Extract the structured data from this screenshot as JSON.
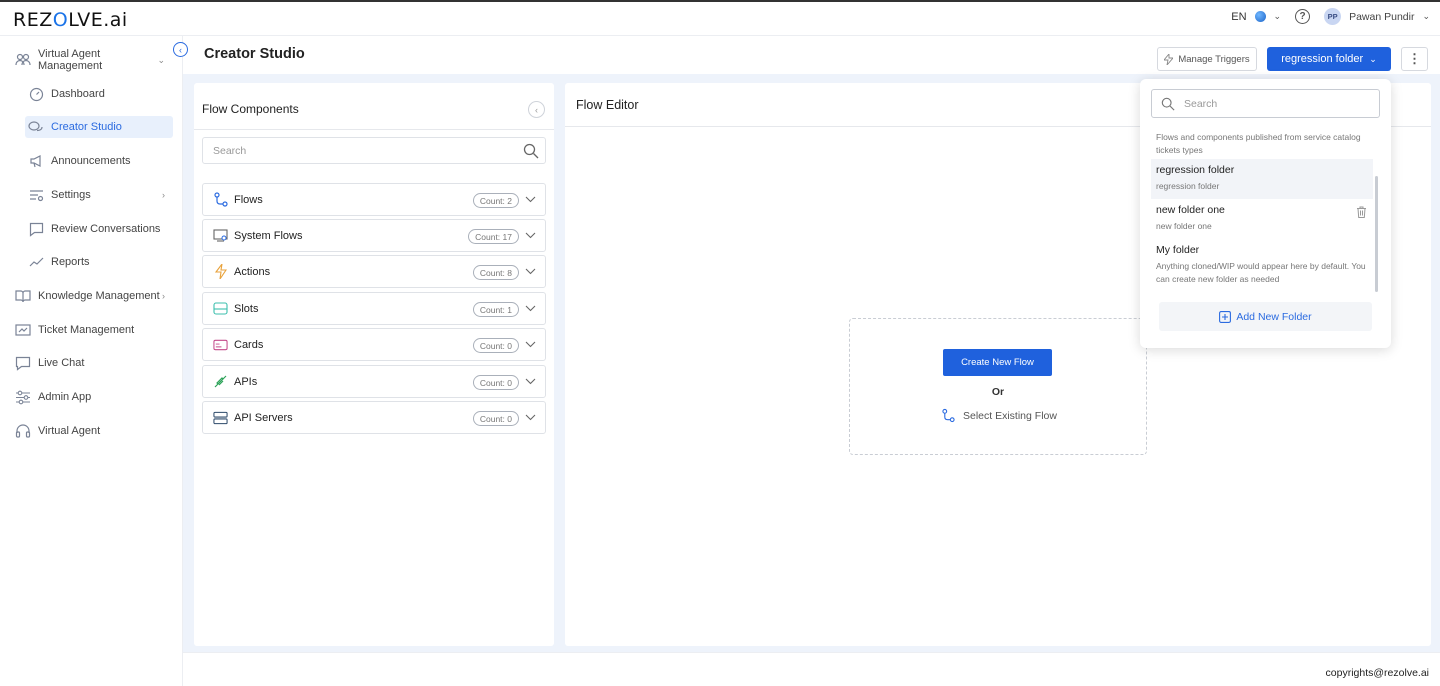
{
  "brand": {
    "logo_pre": "REZ",
    "logo_o": "O",
    "logo_post": "LVE.ai"
  },
  "topbar": {
    "language": "EN",
    "user_initials": "PP",
    "user_name": "Pawan Pundir"
  },
  "sidebar": {
    "items": [
      {
        "label": "Virtual Agent Management",
        "icon": "users-gear-icon"
      },
      {
        "label": "Dashboard",
        "icon": "gauge-icon"
      },
      {
        "label": "Creator Studio",
        "icon": "chat-bubbles-icon"
      },
      {
        "label": "Announcements",
        "icon": "megaphone-icon"
      },
      {
        "label": "Settings",
        "icon": "sliders-icon"
      },
      {
        "label": "Review Conversations",
        "icon": "chat-square-icon"
      },
      {
        "label": "Reports",
        "icon": "trend-icon"
      },
      {
        "label": "Knowledge Management",
        "icon": "book-icon"
      },
      {
        "label": "Ticket Management",
        "icon": "ticket-icon"
      },
      {
        "label": "Live Chat",
        "icon": "live-chat-icon"
      },
      {
        "label": "Admin App",
        "icon": "admin-sliders-icon"
      },
      {
        "label": "Virtual Agent",
        "icon": "headset-icon"
      }
    ]
  },
  "header": {
    "title": "Creator Studio",
    "manage_triggers": "Manage Triggers",
    "folder_button": "regression folder"
  },
  "flow_components": {
    "title": "Flow Components",
    "search_placeholder": "Search",
    "rows": [
      {
        "label": "Flows",
        "count": "Count: 2"
      },
      {
        "label": "System Flows",
        "count": "Count: 17"
      },
      {
        "label": "Actions",
        "count": "Count: 8"
      },
      {
        "label": "Slots",
        "count": "Count: 1"
      },
      {
        "label": "Cards",
        "count": "Count: 0"
      },
      {
        "label": "APIs",
        "count": "Count: 0"
      },
      {
        "label": "API Servers",
        "count": "Count: 0"
      }
    ]
  },
  "flow_editor": {
    "title": "Flow Editor",
    "create_button": "Create New Flow",
    "or_text": "Or",
    "select_existing": "Select Existing Flow"
  },
  "folder_dropdown": {
    "search_placeholder": "Search",
    "items": [
      {
        "name": "",
        "desc": "Flows and components published from service catalog tickets types"
      },
      {
        "name": "regression folder",
        "desc": "regression folder"
      },
      {
        "name": "new folder one",
        "desc": "new folder one"
      },
      {
        "name": "My folder",
        "desc": "Anything cloned/WIP would appear here by default. You can create new folder as needed"
      }
    ],
    "add_label": "Add New Folder"
  },
  "footer": {
    "copyright": "copyrights@rezolve.ai"
  },
  "colors": {
    "accent": "#1f61dd",
    "active_bg": "#e8f0fc",
    "content_bg": "#eef3fb"
  }
}
